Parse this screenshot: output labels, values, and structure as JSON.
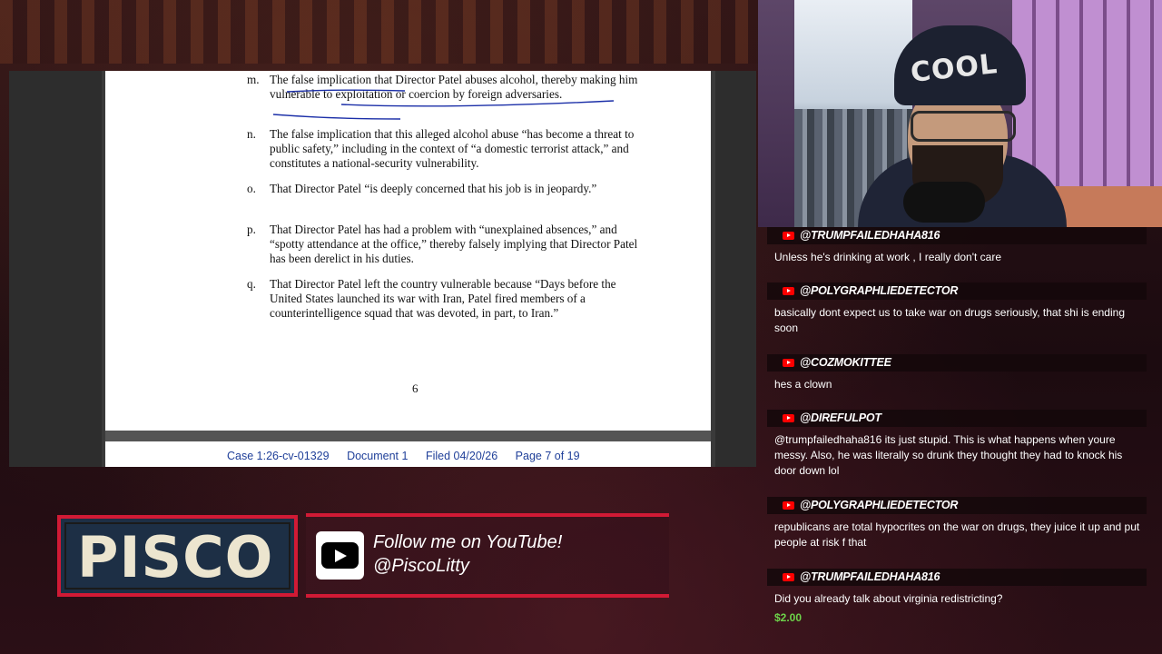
{
  "document": {
    "items": [
      {
        "letter": "m.",
        "text": "The false implication that Director Patel abuses alcohol, thereby making him vulnerable to exploitation or coercion by foreign adversaries."
      },
      {
        "letter": "n.",
        "text": "The false implication that this alleged alcohol abuse “has become a threat to public safety,” including in the context of “a domestic terrorist attack,” and constitutes a national-security vulnerability."
      },
      {
        "letter": "o.",
        "text": "That Director Patel “is deeply concerned that his job is in jeopardy.”"
      },
      {
        "letter": "p.",
        "text": "That Director Patel has had a problem with “unexplained absences,” and “spotty attendance at the office,” thereby falsely implying that Director Patel has been derelict in his duties."
      },
      {
        "letter": "q.",
        "text": "That Director Patel left the country vulnerable because “Days before the United States launched its war with Iran, Patel fired members of a counterintelligence squad that was devoted, in part, to Iran.”"
      }
    ],
    "page_number": "6",
    "next_page_header": {
      "case": "Case 1:26-cv-01329",
      "document": "Document 1",
      "filed": "Filed 04/20/26",
      "page": "Page 7 of 19"
    }
  },
  "webcam": {
    "beanie_text": "COOL"
  },
  "chat": {
    "messages": [
      {
        "user": "@TRUMPFAILEDHAHA816",
        "text": "Unless he's drinking at work , I really don't care"
      },
      {
        "user": "@POLYGRAPHLIEDETECTOR",
        "text": "basically dont expect us to take war on drugs seriously, that shi is ending soon"
      },
      {
        "user": "@COZMOKITTEE",
        "text": "hes a clown"
      },
      {
        "user": "@DIREFULPOT",
        "text": "@trumpfailedhaha816 its just stupid. This is what happens when youre messy. Also, he was literally so drunk they thought they had to knock his door down lol"
      },
      {
        "user": "@POLYGRAPHLIEDETECTOR",
        "text": "republicans are total hypocrites on the war on drugs, they juice it up and put people at risk f that"
      },
      {
        "user": "@TRUMPFAILEDHAHA816",
        "text": "Did you already talk about virginia redistricting?",
        "amount": "$2.00"
      }
    ]
  },
  "branding": {
    "name": "PISCO",
    "follow_line1": "Follow me on YouTube!",
    "follow_line2": "@PiscoLitty"
  },
  "colors": {
    "accent": "#d11a35",
    "chat_amount": "#6dd34a",
    "ink": "#1b2fa8",
    "youtube": "#ff0000"
  }
}
